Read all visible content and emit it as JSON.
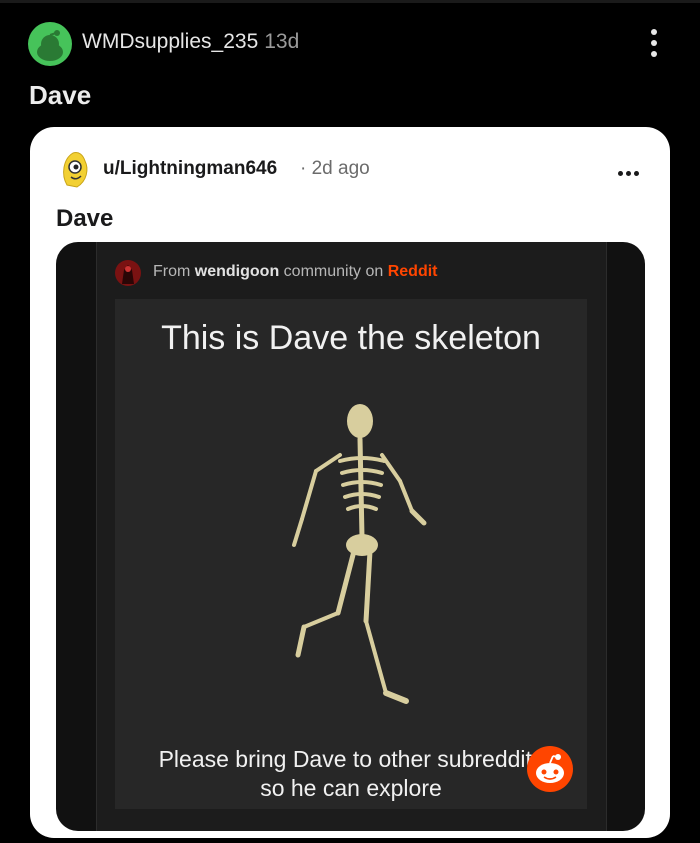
{
  "post": {
    "author": "WMDsupplies_235",
    "age": "13d",
    "title": "Dave"
  },
  "crosspost": {
    "author": "u/Lightningman646",
    "time": "2d ago",
    "title": "Dave"
  },
  "embed": {
    "from_prefix": "From",
    "community": "wendigoon",
    "community_mid": "community on",
    "platform": "Reddit"
  },
  "meme": {
    "top_text": "This is Dave the skeleton",
    "bottom_line_1": "Please bring Dave to other subreddits",
    "bottom_line_2": "so he can explore"
  },
  "colors": {
    "background": "#000000",
    "avatar_green": "#46c35a",
    "reddit_orange": "#ff4500"
  }
}
